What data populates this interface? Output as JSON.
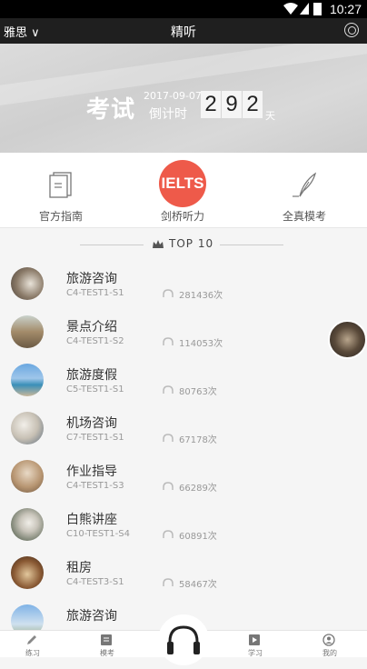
{
  "status": {
    "time": "10:27"
  },
  "header": {
    "exam": "雅思 ∨",
    "title": "精听"
  },
  "banner": {
    "label": "考试",
    "date": "2017-09-07",
    "countdown_label": "倒计时",
    "digits": [
      "2",
      "9",
      "2"
    ],
    "unit": "天"
  },
  "categories": [
    {
      "label": "官方指南",
      "icon": "book-icon"
    },
    {
      "label": "剑桥听力",
      "icon": "ielts-logo",
      "badge": "IELTS"
    },
    {
      "label": "全真模考",
      "icon": "feather-icon"
    }
  ],
  "top": {
    "title": "TOP  10"
  },
  "list": [
    {
      "name": "旅游咨询",
      "code": "C4-TEST1-S1",
      "plays": "281436次"
    },
    {
      "name": "景点介绍",
      "code": "C4-TEST1-S2",
      "plays": "114053次"
    },
    {
      "name": "旅游度假",
      "code": "C5-TEST1-S1",
      "plays": "80763次"
    },
    {
      "name": "机场咨询",
      "code": "C7-TEST1-S1",
      "plays": "67178次"
    },
    {
      "name": "作业指导",
      "code": "C4-TEST1-S3",
      "plays": "66289次"
    },
    {
      "name": "白熊讲座",
      "code": "C10-TEST1-S4",
      "plays": "60891次"
    },
    {
      "name": "租房",
      "code": "C4-TEST3-S1",
      "plays": "58467次"
    },
    {
      "name": "旅游咨询",
      "code": "",
      "plays": ""
    }
  ],
  "tabs": [
    {
      "label": "练习",
      "icon": "pencil-icon"
    },
    {
      "label": "模考",
      "icon": "document-icon"
    },
    {
      "label": "学习",
      "icon": "play-icon"
    },
    {
      "label": "我的",
      "icon": "user-icon"
    }
  ],
  "colors": {
    "accent": "#ee5a4a",
    "title_bar": "#1f1f1f"
  }
}
